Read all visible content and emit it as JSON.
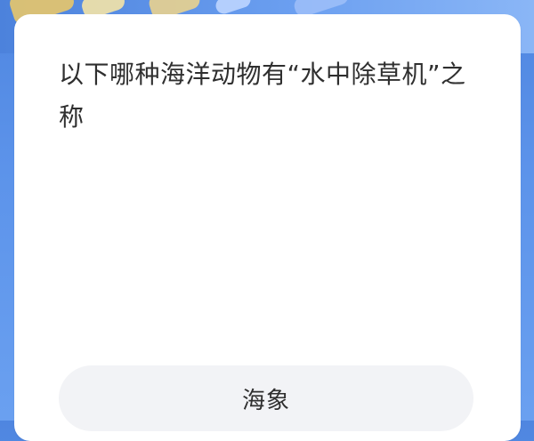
{
  "quiz": {
    "question": "以下哪种海洋动物有“水中除草机”之称",
    "options": [
      {
        "label": "海象"
      }
    ]
  }
}
